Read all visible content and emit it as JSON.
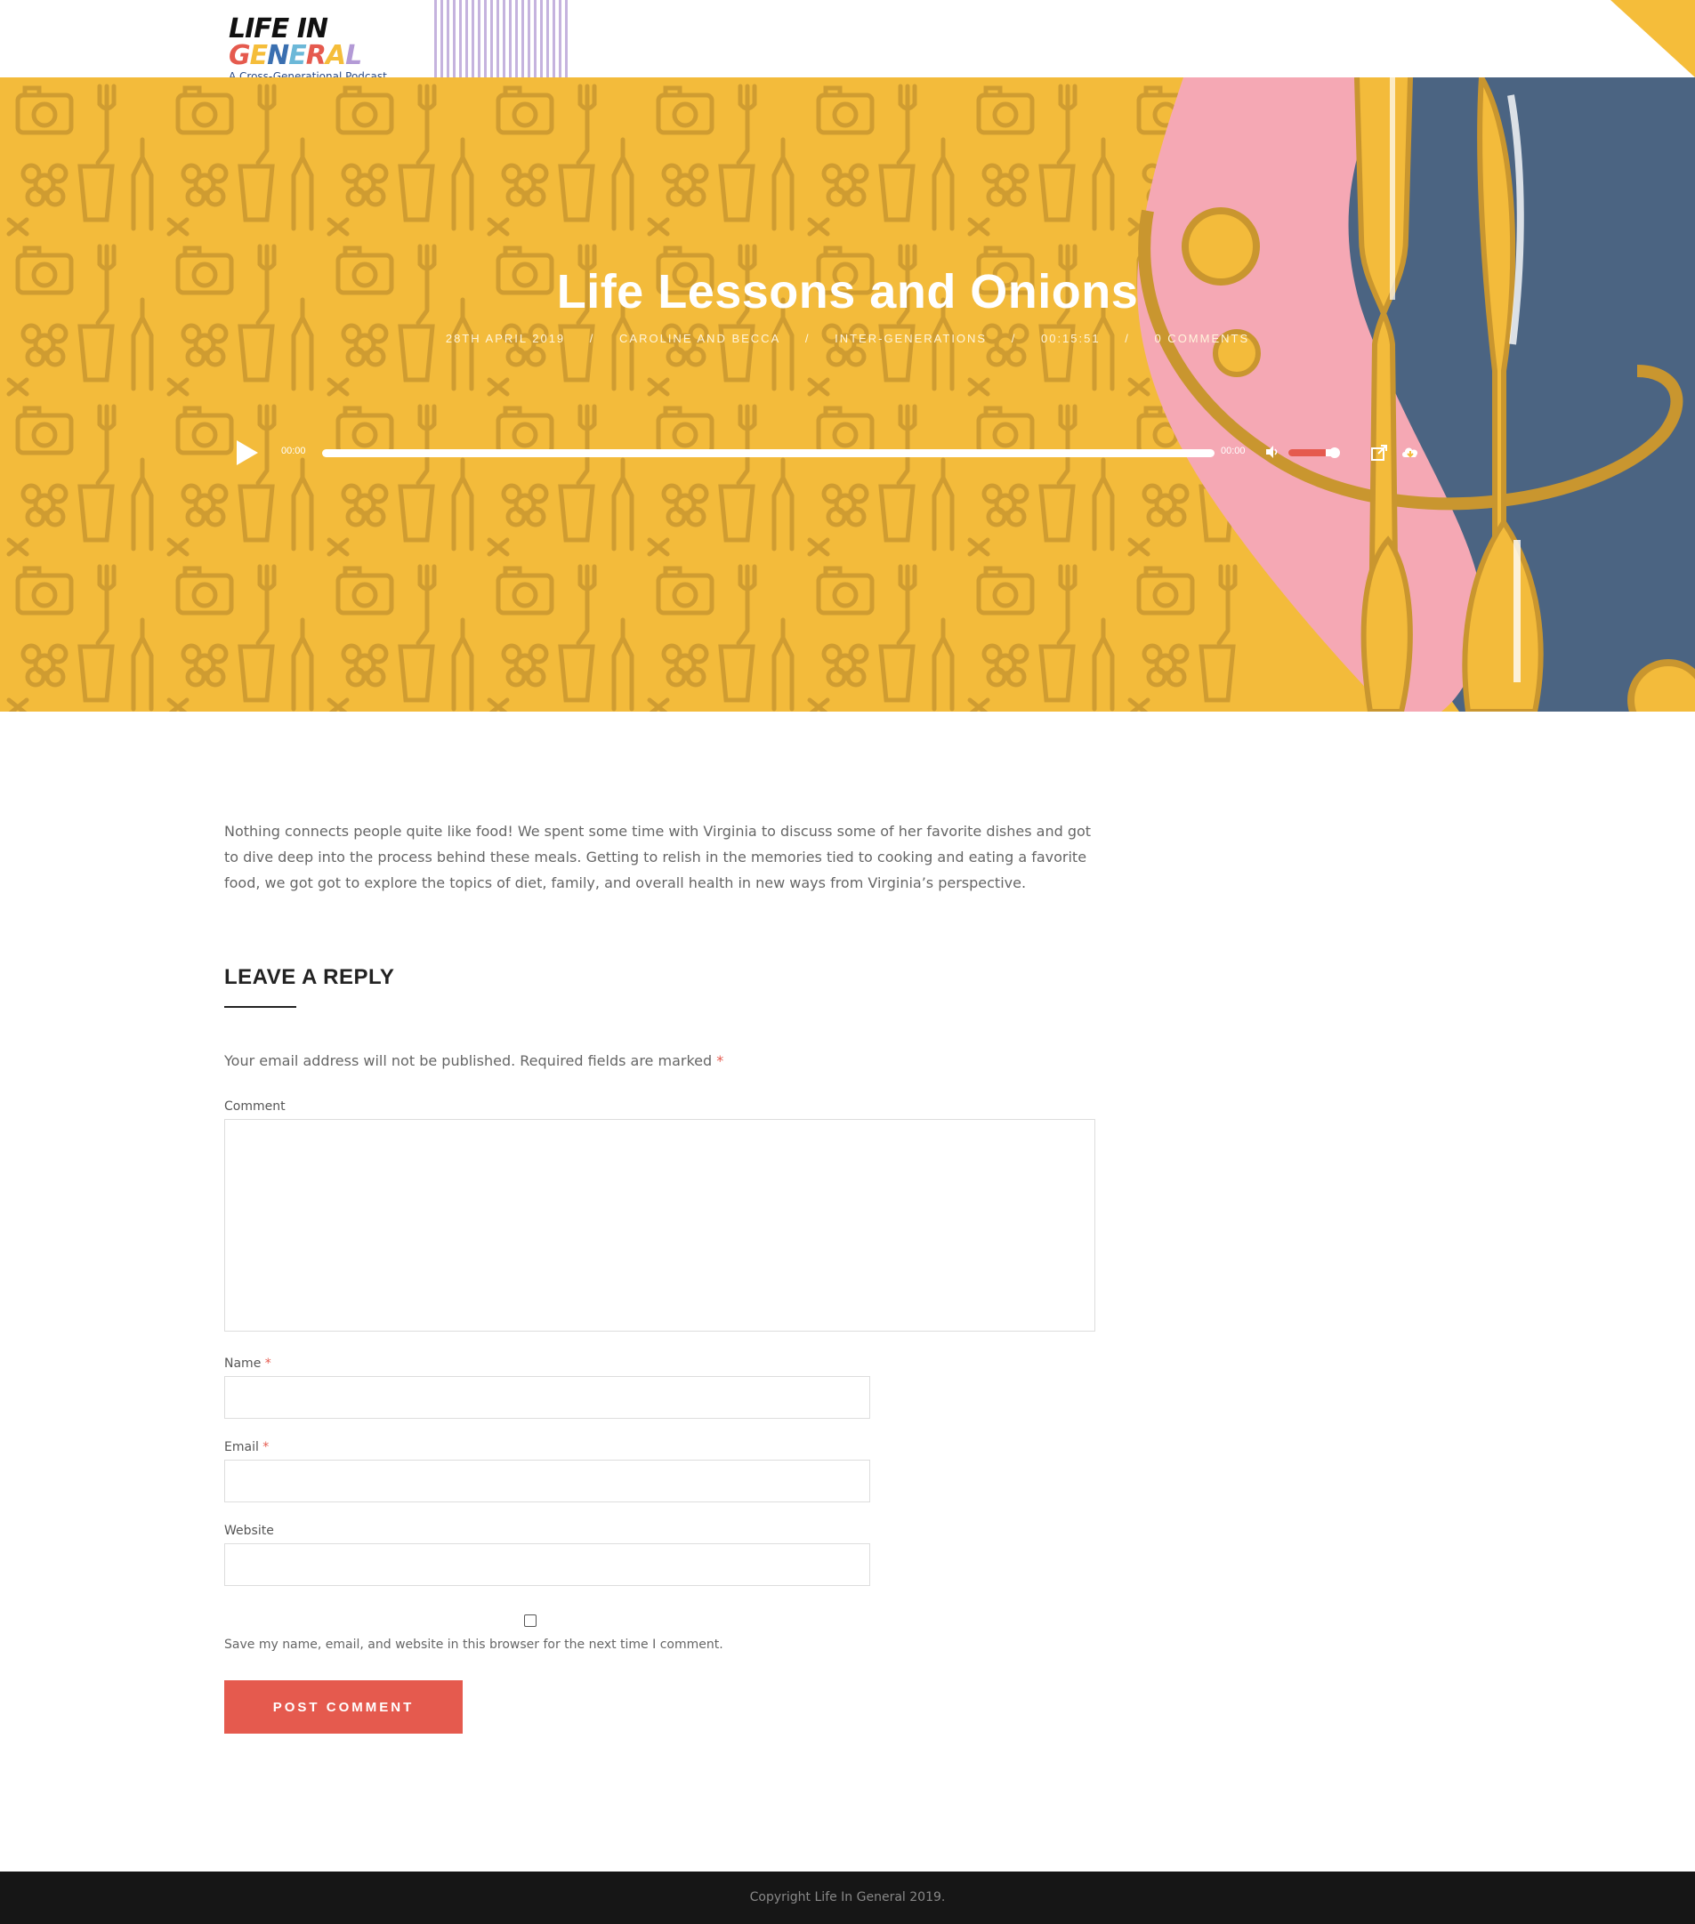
{
  "header": {
    "logo_title_parts": [
      "LIFE ",
      "IN ",
      "G",
      "E",
      "N",
      "E",
      "R",
      "A",
      "L"
    ],
    "logo_subtitle": "A Cross-Generational Podcast"
  },
  "hero": {
    "title": "Life Lessons and Onions",
    "meta": {
      "date": "28TH APRIL 2019",
      "author": "CAROLINE AND BECCA",
      "category": "INTER-GENERATIONS",
      "duration": "00:15:51",
      "comments": "0 COMMENTS",
      "separator": "/"
    }
  },
  "player": {
    "current_time": "00:00",
    "duration_time": "00:00",
    "progress": 0,
    "volume": 0.8,
    "accent": "#e55a4e"
  },
  "post": {
    "description": "Nothing connects people quite like food! We spent some time with Virginia to discuss some of her favorite dishes and got to dive deep into the process behind these meals. Getting to relish in the memories tied to cooking and eating a favorite food, we got got to explore the topics of diet, family, and overall health in new ways from Virginia’s perspective."
  },
  "reply": {
    "title": "LEAVE A REPLY",
    "notes": "Your email address will not be published. Required fields are marked",
    "required_mark": "*",
    "comment_label": "Comment",
    "name_label": "Name",
    "email_label": "Email",
    "website_label": "Website",
    "cookies_label": "Save my name, email, and website in this browser for the next time I comment.",
    "submit_label": "POST COMMENT"
  },
  "footer": {
    "copyright": "Copyright Life In General 2019."
  },
  "colors": {
    "hero_yellow": "#f3bb3b",
    "pattern": "#c9962f",
    "pink": "#f5a8b4",
    "navy": "#4b6482",
    "accent": "#e55a4e",
    "footer": "#161616"
  }
}
